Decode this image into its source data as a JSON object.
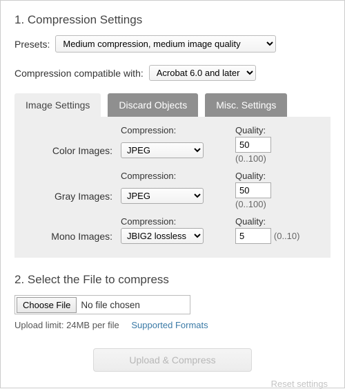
{
  "section1_title": "1. Compression Settings",
  "presets_label": "Presets:",
  "presets_value": "Medium compression, medium image quality",
  "compat_label": "Compression compatible with:",
  "compat_value": "Acrobat 6.0 and later",
  "tabs": {
    "image": "Image Settings",
    "discard": "Discard Objects",
    "misc": "Misc. Settings"
  },
  "headers": {
    "compression": "Compression:",
    "quality": "Quality:"
  },
  "rows": {
    "color": {
      "label": "Color Images:",
      "compression": "JPEG",
      "quality": "50",
      "range": "(0..100)"
    },
    "gray": {
      "label": "Gray Images:",
      "compression": "JPEG",
      "quality": "50",
      "range": "(0..100)"
    },
    "mono": {
      "label": "Mono Images:",
      "compression": "JBIG2 lossless",
      "quality": "5",
      "range": "(0..10)"
    }
  },
  "section2_title": "2. Select the File to compress",
  "choose_label": "Choose File",
  "file_status": "No file chosen",
  "upload_limit": "Upload limit: 24MB per file",
  "supported_link": "Supported Formats",
  "upload_button": "Upload & Compress",
  "reset_link": "Reset settings"
}
